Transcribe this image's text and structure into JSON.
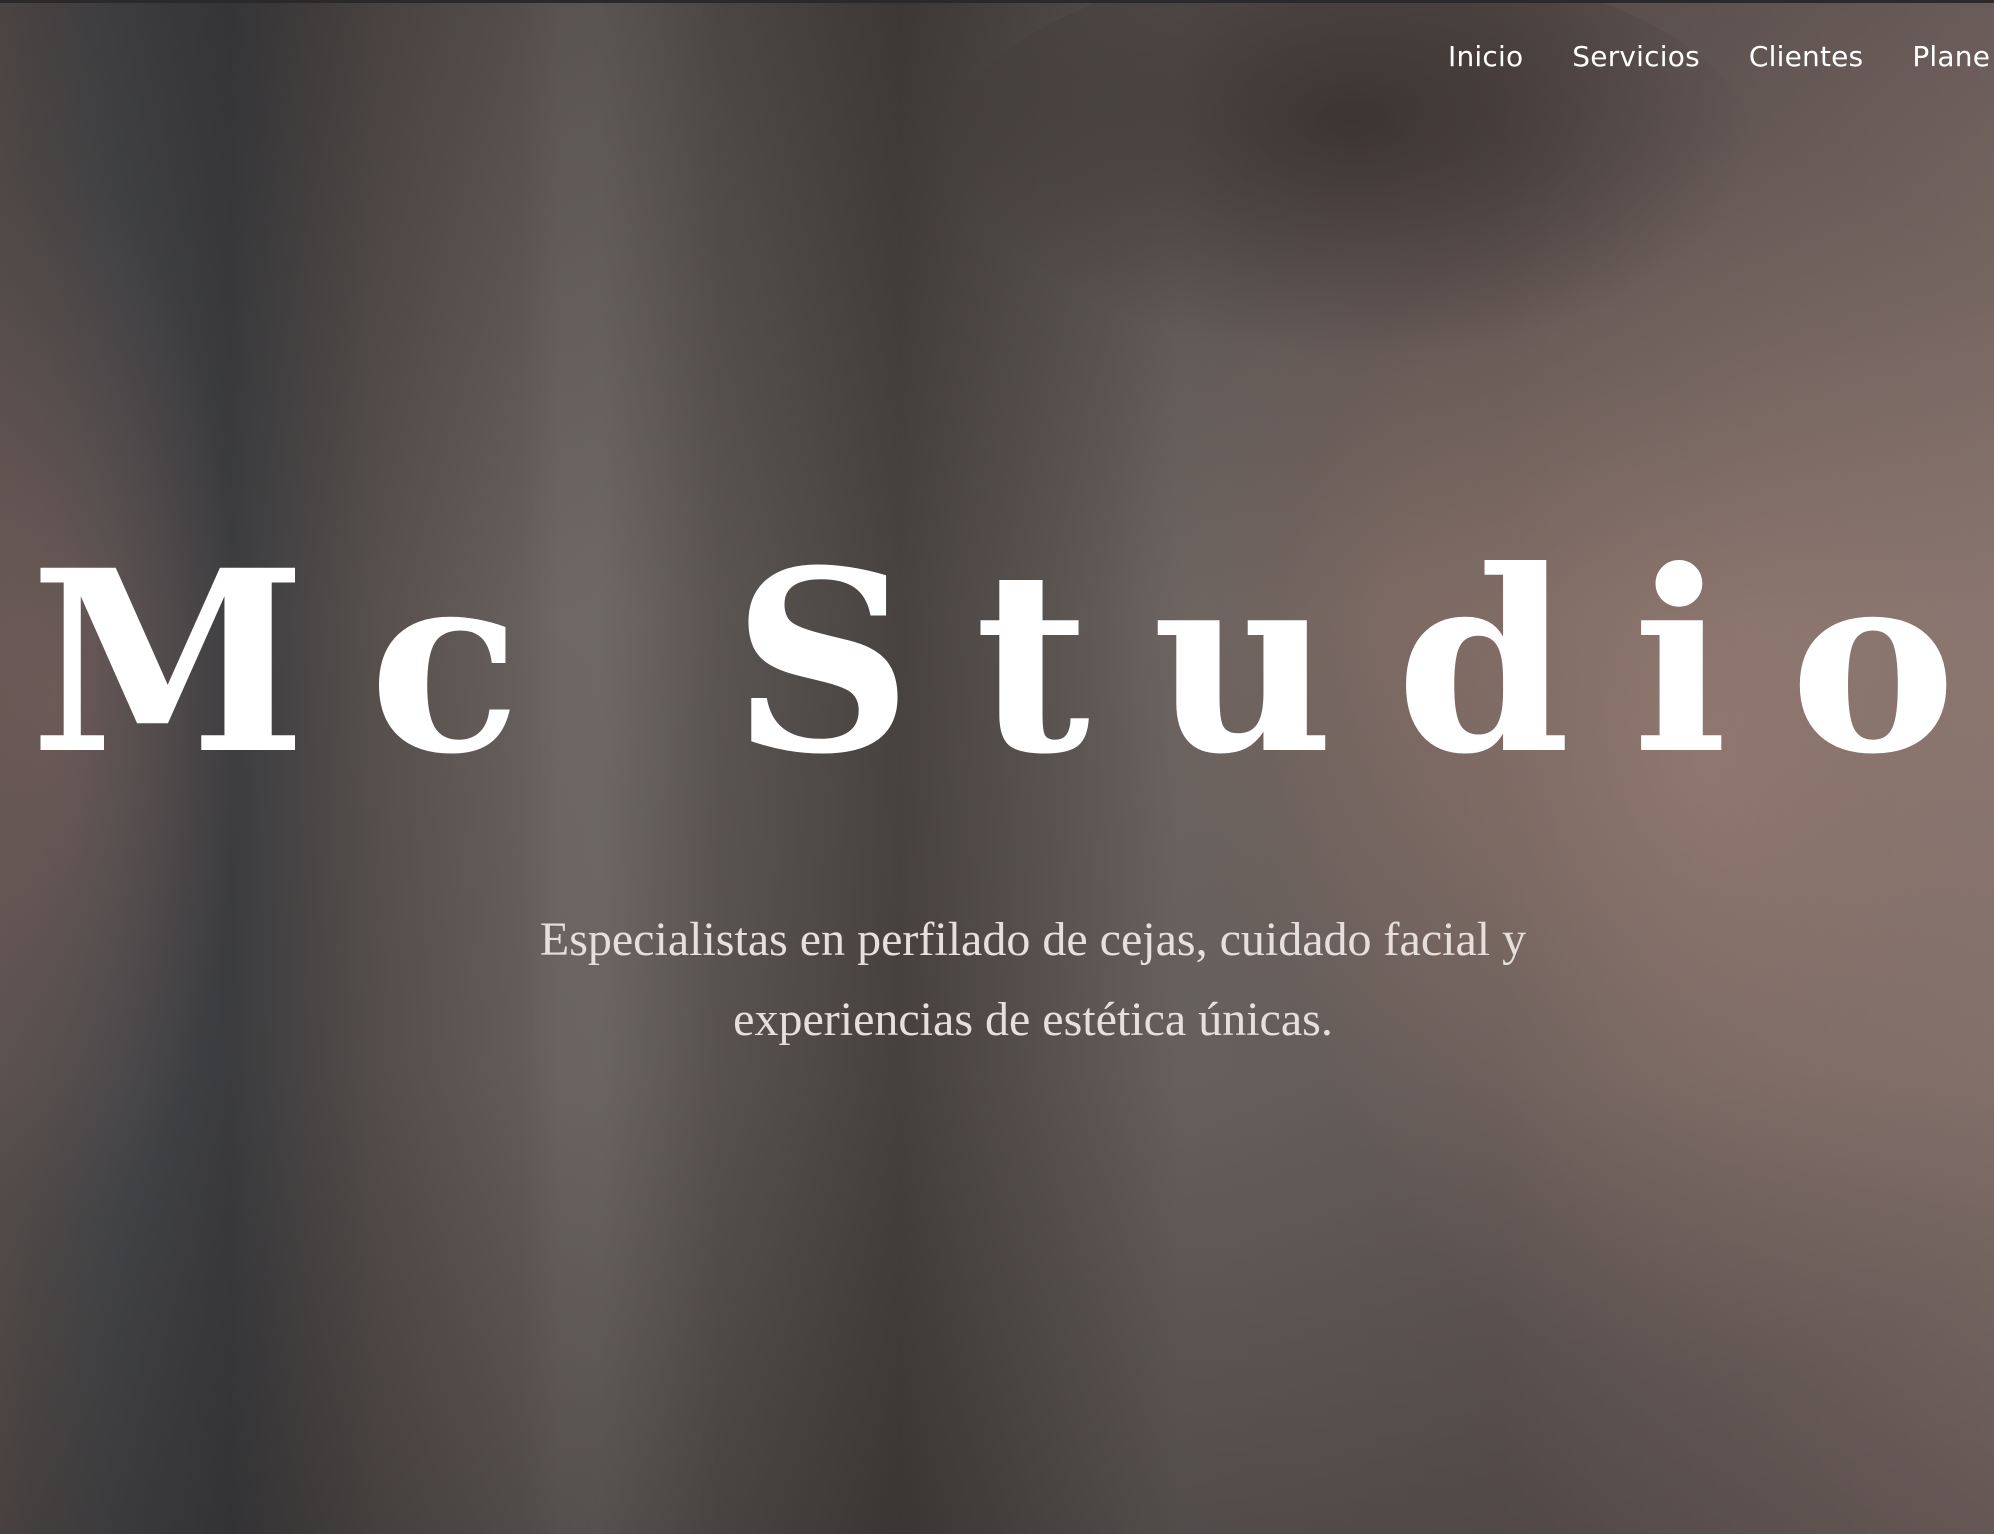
{
  "nav": {
    "items": [
      {
        "label": "Inicio"
      },
      {
        "label": "Servicios"
      },
      {
        "label": "Clientes"
      },
      {
        "label": "Plane"
      }
    ]
  },
  "hero": {
    "title": "Mc Studio",
    "subtitle_line1": "Especialistas en perfilado de cejas, cuidado facial y",
    "subtitle_line2": "experiencias de estética únicas."
  },
  "colors": {
    "text": "#ffffff",
    "subtitle": "#e7dfdc",
    "overlay": "#4a4442"
  }
}
